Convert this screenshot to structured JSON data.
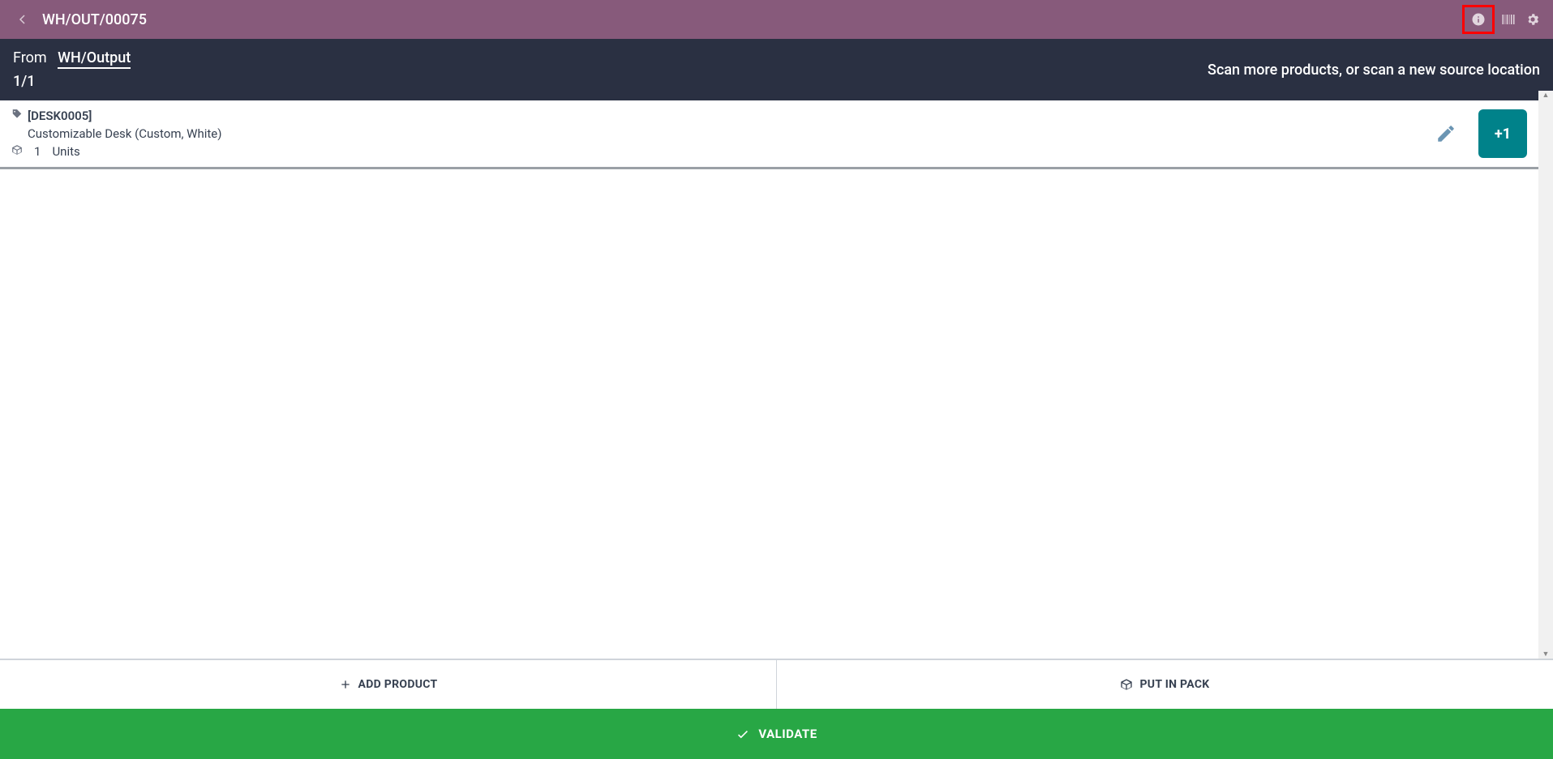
{
  "topbar": {
    "title": "WH/OUT/00075"
  },
  "subheader": {
    "from_label": "From",
    "from_location": "WH/Output",
    "counter": "1/1",
    "hint": "Scan more products, or scan a new source location"
  },
  "product": {
    "code": "[DESK0005]",
    "name": "Customizable Desk (Custom, White)",
    "qty": "1",
    "uom": "Units",
    "plus_label": "+1"
  },
  "actions": {
    "add_product": "ADD PRODUCT",
    "put_in_pack": "PUT IN PACK",
    "validate": "VALIDATE"
  }
}
